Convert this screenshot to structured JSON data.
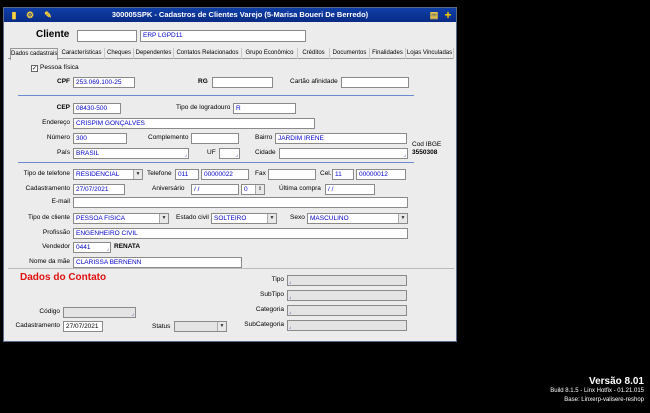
{
  "window": {
    "title": "300005SPK - Cadastros de Clientes Varejo (5-Marisa Boueri De Berredo)"
  },
  "header": {
    "cliente_label": "Cliente",
    "cliente_code": "",
    "cliente_name": "ERP LGPD11"
  },
  "tabs": [
    "Dados cadastrais",
    "Características",
    "Cheques",
    "Dependentes",
    "Contatos Relacionados",
    "Grupo Econômico",
    "Créditos",
    "Documentos",
    "Finalidades",
    "Lojas Vinculadas"
  ],
  "form": {
    "pessoa_fisica": "Pessoa física",
    "cpf_label": "CPF",
    "cpf": "253.069.100-25",
    "rg_label": "RG",
    "rg": "",
    "cartao_label": "Cartão afinidade",
    "cartao": "",
    "cep_label": "CEP",
    "cep": "08430-500",
    "tipo_logr_label": "Tipo de logradouro",
    "tipo_logr": "R",
    "endereco_label": "Endereço",
    "endereco": "CRISPIM GONÇALVES",
    "numero_label": "Número",
    "numero": "300",
    "complemento_label": "Complemento",
    "complemento": "",
    "bairro_label": "Bairro",
    "bairro": "JARDIM IRENE",
    "pais_label": "País",
    "pais": "BRASIL",
    "uf_label": "UF",
    "uf": "",
    "cidade_label": "Cidade",
    "cidade": "",
    "codibge_label": "Cod IBGE",
    "codibge": "3550308",
    "tipo_tel_label": "Tipo de telefone",
    "tipo_tel": "RESIDENCIAL",
    "telefone_label": "Telefone",
    "tel_ddd": "011",
    "tel_num": "00000022",
    "fax_label": "Fax",
    "fax": "",
    "cel_label": "Cel.",
    "cel_ddd": "11",
    "cel_num": "00000012",
    "cadastro_label": "Cadastramento",
    "cadastro": "27/07/2021",
    "aniversario_label": "Aniversário",
    "aniversario": " /  /",
    "aniv_spin": "0",
    "ultima_label": "Última compra",
    "ultima": " /  /",
    "email_label": "E-mail",
    "email": "",
    "tipo_cli_label": "Tipo de cliente",
    "tipo_cli": "PESSOA FISICA",
    "estado_civil_label": "Estado civil",
    "estado_civil": "SOLTEIRO",
    "sexo_label": "Sexo",
    "sexo": "MASCULINO",
    "profissao_label": "Profissão",
    "profissao": "ENGENHEIRO CIVIL",
    "vendedor_label": "Vendedor",
    "vendedor_code": "0441",
    "vendedor_name": "RENATA",
    "mae_label": "Nome da mãe",
    "mae": "CLARISSA BERNENN"
  },
  "contato": {
    "title": "Dados do Contato",
    "tipo_label": "Tipo",
    "subtipo_label": "SubTipo",
    "categoria_label": "Categoria",
    "subcategoria_label": "SubCategoria",
    "codigo_label": "Código",
    "codigo": "",
    "cadastro_label": "Cadastramento",
    "cadastro": "27/07/2021",
    "status_label": "Status",
    "status": ""
  },
  "version": {
    "name": "Versão  8.01",
    "build": "Build 8.1.5 - Linx Hotfix - 01.21.015",
    "base": "Base: Linxerp-valisere-reshop"
  }
}
